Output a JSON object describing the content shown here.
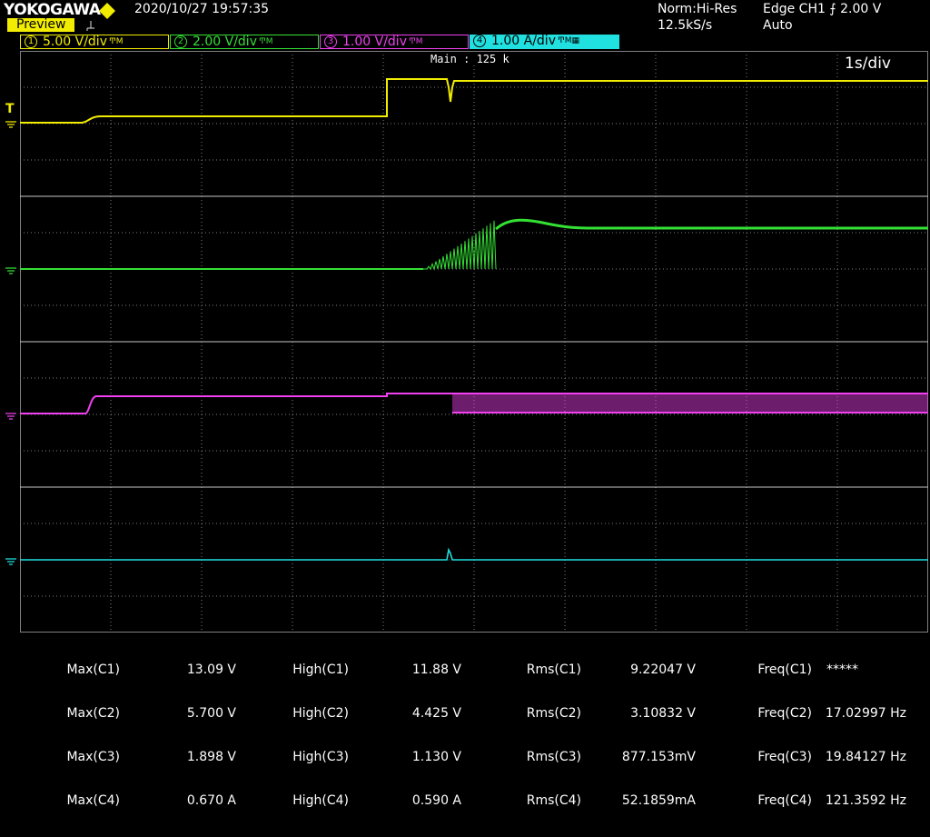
{
  "header": {
    "brand": "YOKOGAWA",
    "preview_label": "Preview",
    "datetime": "2020/10/27  19:57:35",
    "acq_mode": "Norm:Hi-Res",
    "sample_rate": "12.5kS/s",
    "trigger": "Edge CH1 ⨍ 2.00 V",
    "trigger_mode": "Auto"
  },
  "channels": [
    {
      "num": "1",
      "scale": "5.00 V/div",
      "color": "#f1ec00"
    },
    {
      "num": "2",
      "scale": "2.00 V/div",
      "color": "#34e034"
    },
    {
      "num": "3",
      "scale": "1.00 V/div",
      "color": "#f040f0"
    },
    {
      "num": "4",
      "scale": "1.00 A/div",
      "color": "#20e0e0"
    }
  ],
  "display": {
    "zoom_label": "Main : 125 k",
    "timebase": "1s/div",
    "trigger_marker": "T"
  },
  "measurements": {
    "max": [
      {
        "label": "Max(C1)",
        "value": "13.09 V"
      },
      {
        "label": "Max(C2)",
        "value": "5.700 V"
      },
      {
        "label": "Max(C3)",
        "value": "1.898 V"
      },
      {
        "label": "Max(C4)",
        "value": "0.670 A"
      }
    ],
    "high": [
      {
        "label": "High(C1)",
        "value": "11.88 V"
      },
      {
        "label": "High(C2)",
        "value": "4.425 V"
      },
      {
        "label": "High(C3)",
        "value": "1.130 V"
      },
      {
        "label": "High(C4)",
        "value": "0.590 A"
      }
    ],
    "rms": [
      {
        "label": "Rms(C1)",
        "value": "9.22047 V"
      },
      {
        "label": "Rms(C2)",
        "value": "3.10832 V"
      },
      {
        "label": "Rms(C3)",
        "value": "877.153mV"
      },
      {
        "label": "Rms(C4)",
        "value": "52.1859mA"
      }
    ],
    "freq": [
      {
        "label": "Freq(C1)",
        "value": "*****"
      },
      {
        "label": "Freq(C2)",
        "value": "17.02997 Hz"
      },
      {
        "label": "Freq(C3)",
        "value": "19.84127 Hz"
      },
      {
        "label": "Freq(C4)",
        "value": "121.3592 Hz"
      }
    ]
  },
  "colors": {
    "ch1": "#f1ec00",
    "ch2": "#34e034",
    "ch3": "#f040f0",
    "ch4": "#20e0e0",
    "grid": "#808080"
  },
  "icons": {
    "brand_mark": "yellow-diamond-icon",
    "preview_indicator": "pd-icon",
    "ground": "ground-icon"
  }
}
